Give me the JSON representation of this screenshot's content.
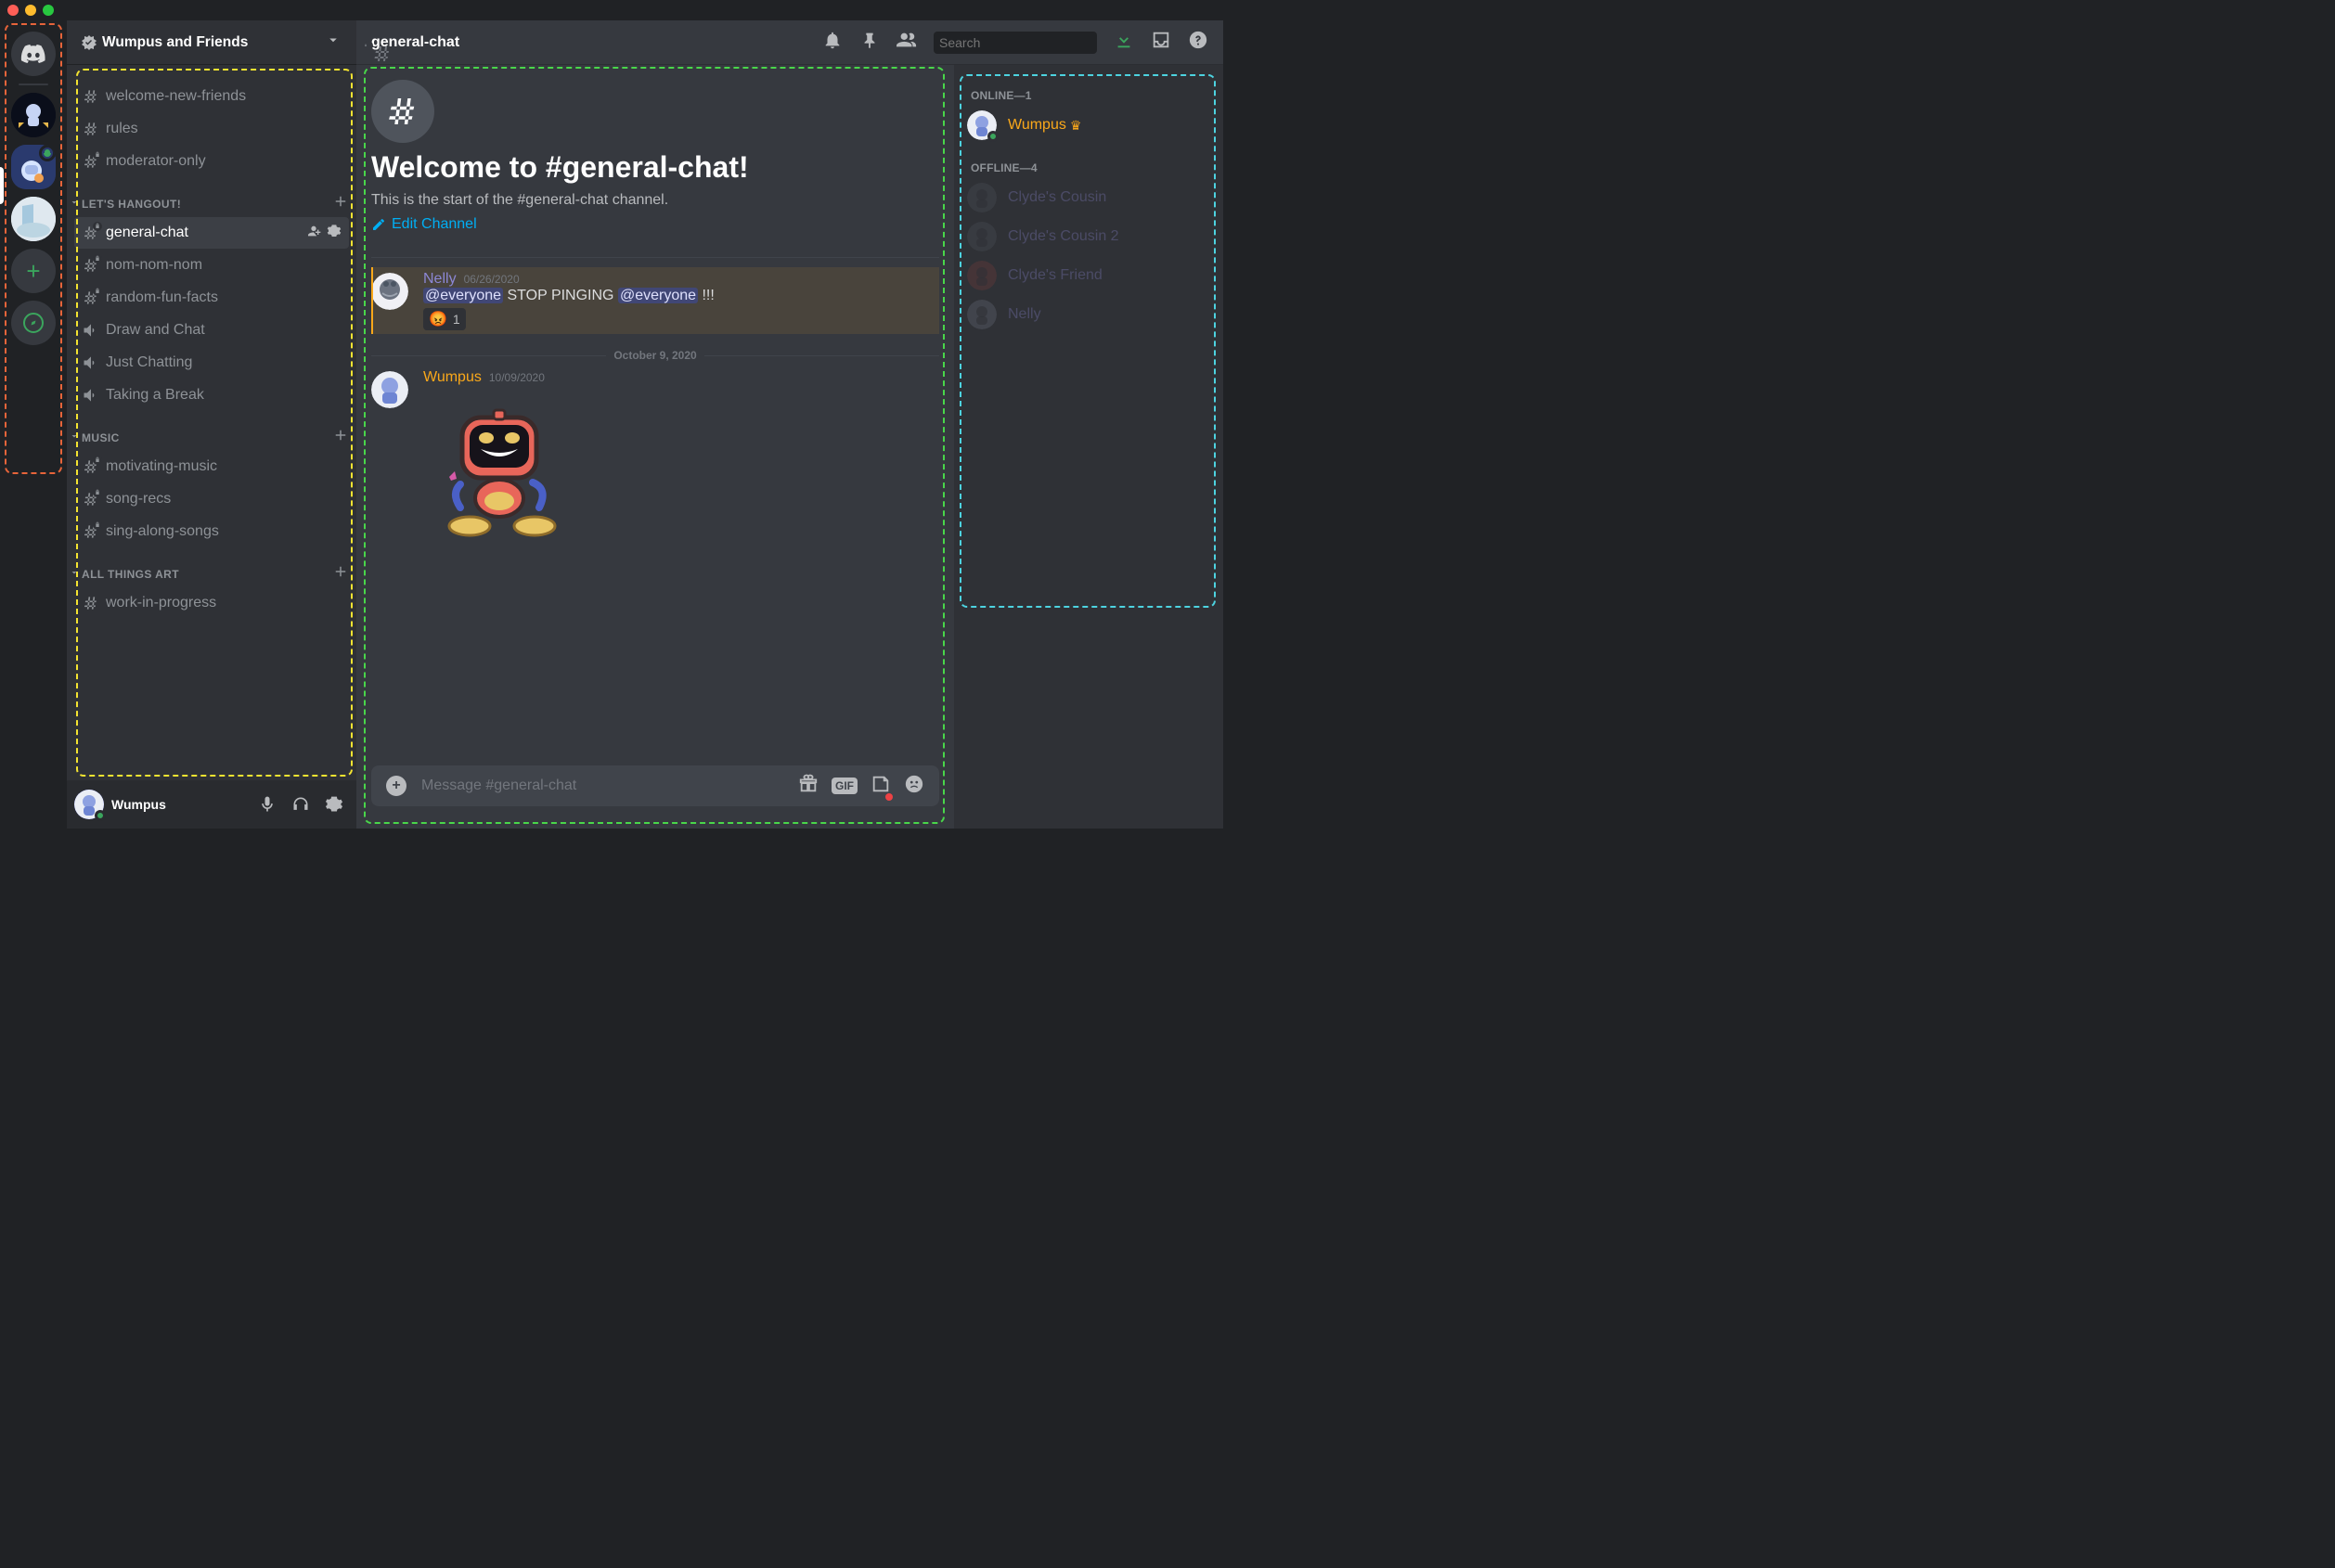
{
  "server": {
    "name": "Wumpus and Friends",
    "current_channel_header": "general-chat"
  },
  "servers_list": [
    {
      "type": "home"
    },
    {
      "type": "avatar"
    },
    {
      "type": "avatar",
      "selected": true
    },
    {
      "type": "avatar"
    },
    {
      "type": "add"
    },
    {
      "type": "compass"
    }
  ],
  "channels": {
    "top": [
      {
        "name": "welcome-new-friends",
        "type": "text",
        "locked": false
      },
      {
        "name": "rules",
        "type": "text",
        "locked": false
      },
      {
        "name": "moderator-only",
        "type": "text",
        "locked": true
      }
    ],
    "categories": [
      {
        "name": "LET'S HANGOUT!",
        "channels": [
          {
            "name": "general-chat",
            "type": "text",
            "locked": true,
            "active": true
          },
          {
            "name": "nom-nom-nom",
            "type": "text",
            "locked": true
          },
          {
            "name": "random-fun-facts",
            "type": "text",
            "locked": true
          },
          {
            "name": "Draw and Chat",
            "type": "voice"
          },
          {
            "name": "Just Chatting",
            "type": "voice"
          },
          {
            "name": "Taking a Break",
            "type": "voice"
          }
        ]
      },
      {
        "name": "MUSIC",
        "channels": [
          {
            "name": "motivating-music",
            "type": "text",
            "locked": true
          },
          {
            "name": "song-recs",
            "type": "text",
            "locked": true
          },
          {
            "name": "sing-along-songs",
            "type": "text",
            "locked": true
          }
        ]
      },
      {
        "name": "ALL THINGS ART",
        "channels": [
          {
            "name": "work-in-progress",
            "type": "text"
          }
        ]
      }
    ]
  },
  "user_panel": {
    "name": "Wumpus"
  },
  "toolbar": {
    "search_placeholder": "Search"
  },
  "welcome": {
    "title": "Welcome to #general-chat!",
    "subtitle": "This is the start of the #general-chat channel.",
    "edit": "Edit Channel"
  },
  "messages": [
    {
      "author": "Nelly",
      "author_color": "#8c87d5",
      "date": "06/26/2020",
      "text_parts": [
        {
          "type": "mention",
          "text": "@everyone"
        },
        {
          "type": "plain",
          "text": " STOP PINGING "
        },
        {
          "type": "mention",
          "text": "@everyone"
        },
        {
          "type": "plain",
          "text": " !!!"
        }
      ],
      "mention_highlight": true,
      "reactions": [
        {
          "emoji": "😡",
          "count": "1"
        }
      ]
    }
  ],
  "day_divider": "October 9, 2020",
  "message2": {
    "author": "Wumpus",
    "author_color": "#faa81a",
    "date": "10/09/2020"
  },
  "compose": {
    "placeholder": "Message #general-chat"
  },
  "members": {
    "online": {
      "label": "ONLINE—1",
      "items": [
        {
          "name": "Wumpus",
          "color": "#faa81a",
          "owner": true
        }
      ]
    },
    "offline": {
      "label": "OFFLINE—4",
      "items": [
        {
          "name": "Clyde's Cousin",
          "color": "#8c87d5"
        },
        {
          "name": "Clyde's Cousin 2",
          "color": "#8c87d5"
        },
        {
          "name": "Clyde's Friend",
          "color": "#8c87d5"
        },
        {
          "name": "Nelly",
          "color": "#8c87d5"
        }
      ]
    }
  },
  "compose_gif_label": "GIF"
}
